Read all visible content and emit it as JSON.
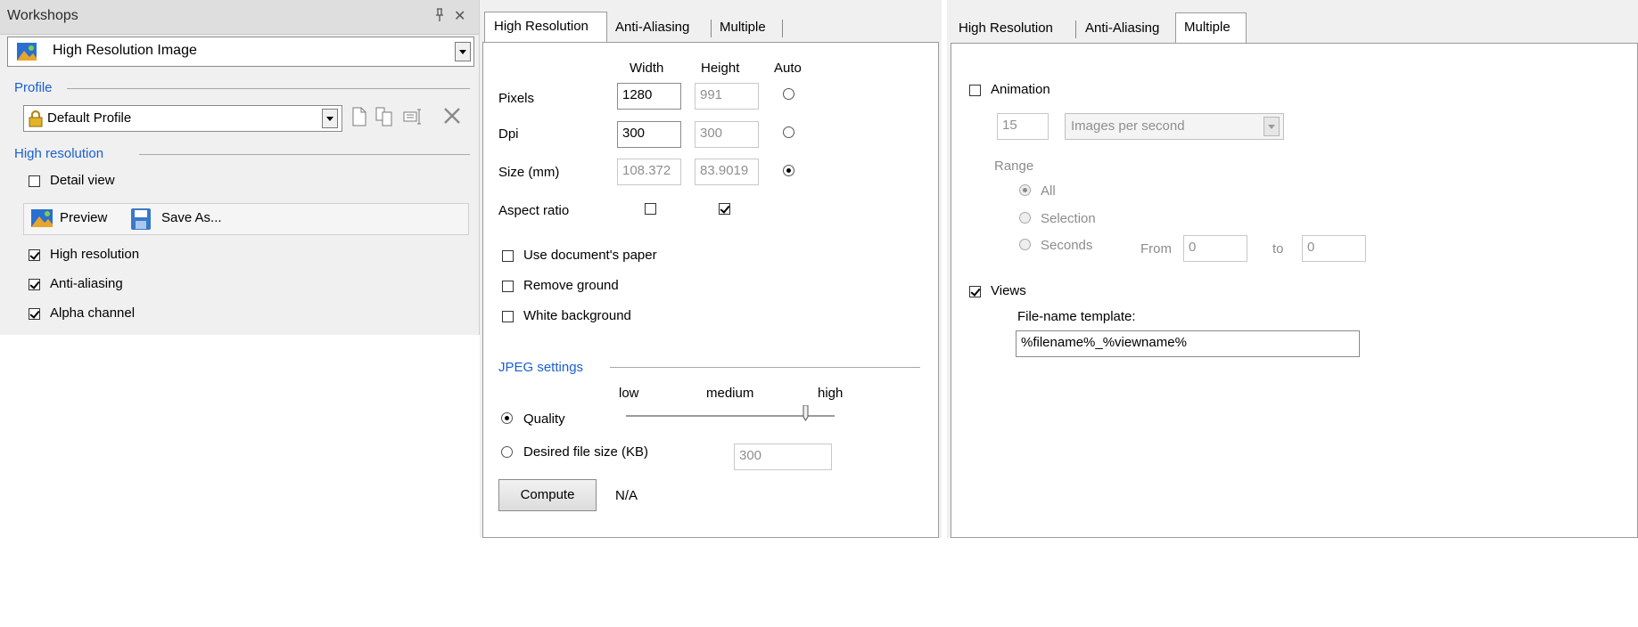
{
  "workshops": {
    "title": "Workshops",
    "pin_glyph": "⊕",
    "close_glyph": "✕",
    "selector_value": "High Resolution Image",
    "profile_group": "Profile",
    "profile_value": "Default Profile",
    "highres_group": "High resolution",
    "detail_view": {
      "label": "Detail view",
      "checked": false
    },
    "preview_label": "Preview",
    "save_as_label": "Save As...",
    "options": [
      {
        "label": "High resolution",
        "checked": true
      },
      {
        "label": "Anti-aliasing",
        "checked": true
      },
      {
        "label": "Alpha channel",
        "checked": true
      }
    ]
  },
  "hires": {
    "tabs": [
      "High Resolution",
      "Anti-Aliasing",
      "Multiple"
    ],
    "active_tab": "High Resolution",
    "col_width": "Width",
    "col_height": "Height",
    "col_auto": "Auto",
    "rows": [
      {
        "label": "Pixels",
        "width": "1280",
        "height": "991",
        "auto": false
      },
      {
        "label": "Dpi",
        "width": "300",
        "height": "300",
        "auto": false
      },
      {
        "label": "Size (mm)",
        "width": "108.372",
        "height": "83.9019",
        "auto": true
      }
    ],
    "aspect_ratio_label": "Aspect ratio",
    "aspect_width": false,
    "aspect_height": true,
    "checks": [
      {
        "label": "Use document's paper",
        "checked": false
      },
      {
        "label": "Remove ground",
        "checked": false
      },
      {
        "label": "White background",
        "checked": false
      }
    ],
    "jpeg_group": "JPEG settings",
    "low": "low",
    "medium": "medium",
    "high": "high",
    "quality_label": "Quality",
    "quality_selected": true,
    "quality_level": 0.86,
    "file_size_label": "Desired file size (KB)",
    "file_size_value": "300",
    "compute_label": "Compute",
    "compute_result": "N/A"
  },
  "multiple": {
    "tabs": [
      "High Resolution",
      "Anti-Aliasing",
      "Multiple"
    ],
    "active_tab": "Multiple",
    "animation": {
      "label": "Animation",
      "checked": false
    },
    "rate_value": "15",
    "rate_unit": "Images per second",
    "range_label": "Range",
    "range_all": "All",
    "range_selection": "Selection",
    "range_seconds": "Seconds",
    "from_label": "From",
    "from_value": "0",
    "to_label": "to",
    "to_value": "0",
    "views": {
      "label": "Views",
      "checked": true
    },
    "template_label": "File-name template:",
    "template_value": "%filename%_%viewname%"
  }
}
